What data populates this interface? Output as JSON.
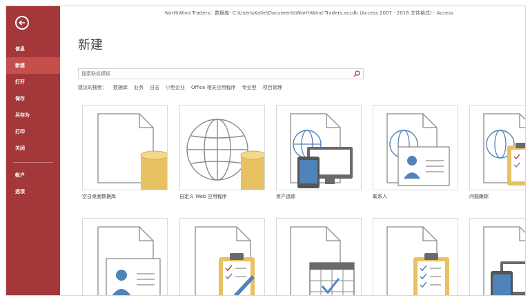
{
  "window": {
    "title": "NorthWind Traders：数据库- C:\\Users\\Katie\\Documents\\NorthWind Traders.accdb (Access 2007 - 2016 文件格式) - Access"
  },
  "sidebar": {
    "items": [
      {
        "label": "信息"
      },
      {
        "label": "新建"
      },
      {
        "label": "打开"
      },
      {
        "label": "保存"
      },
      {
        "label": "另存为"
      },
      {
        "label": "打印"
      },
      {
        "label": "关闭"
      },
      {
        "label": "帐户"
      },
      {
        "label": "选项"
      }
    ]
  },
  "main": {
    "title": "新建",
    "search": {
      "placeholder": "搜索联机模板"
    },
    "tags": [
      "建议的搜索：",
      "数据库",
      "业务",
      "日志",
      "小型企业",
      "Office 相关应用程序",
      "专业型",
      "项目管理"
    ],
    "templates_row1": [
      {
        "label": "空白桌面数据库"
      },
      {
        "label": "自定义 Web 应用程序"
      },
      {
        "label": "资产追踪"
      },
      {
        "label": "联系人"
      },
      {
        "label": "问题跟踪"
      }
    ]
  },
  "colors": {
    "accent": "#a4373a",
    "active": "#c3504d",
    "cylinder": "#e8c163",
    "globe": "#4f83b9",
    "monitor": "#6a6a6a"
  }
}
